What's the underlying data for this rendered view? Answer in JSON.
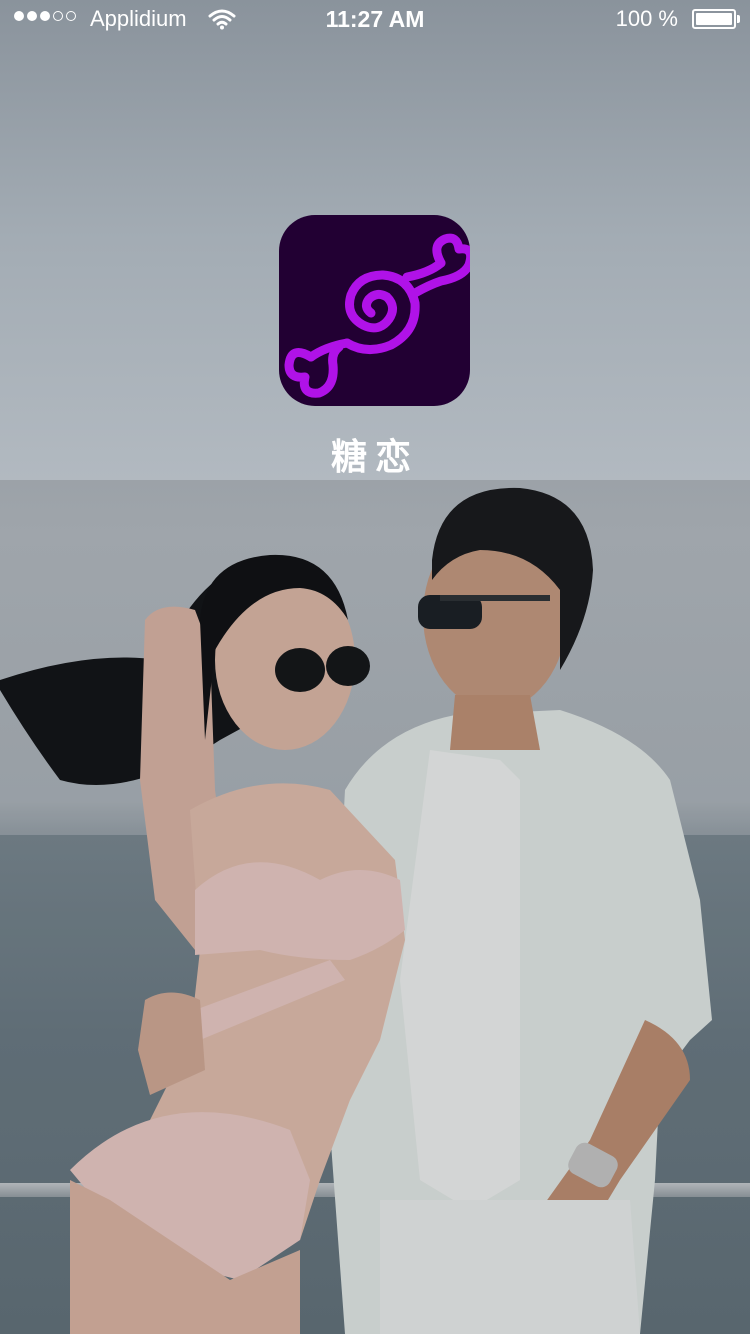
{
  "status_bar": {
    "carrier": "Applidium",
    "time": "11:27 AM",
    "battery_percent": "100 %",
    "battery_level": 1.0,
    "signal_bars_filled": 3,
    "signal_bars_total": 5
  },
  "app": {
    "name": "糖恋",
    "icon": "candy-logo-icon",
    "icon_background": "#220033",
    "icon_accent": "#b012e8"
  },
  "background": {
    "icon": "couple-photo"
  }
}
